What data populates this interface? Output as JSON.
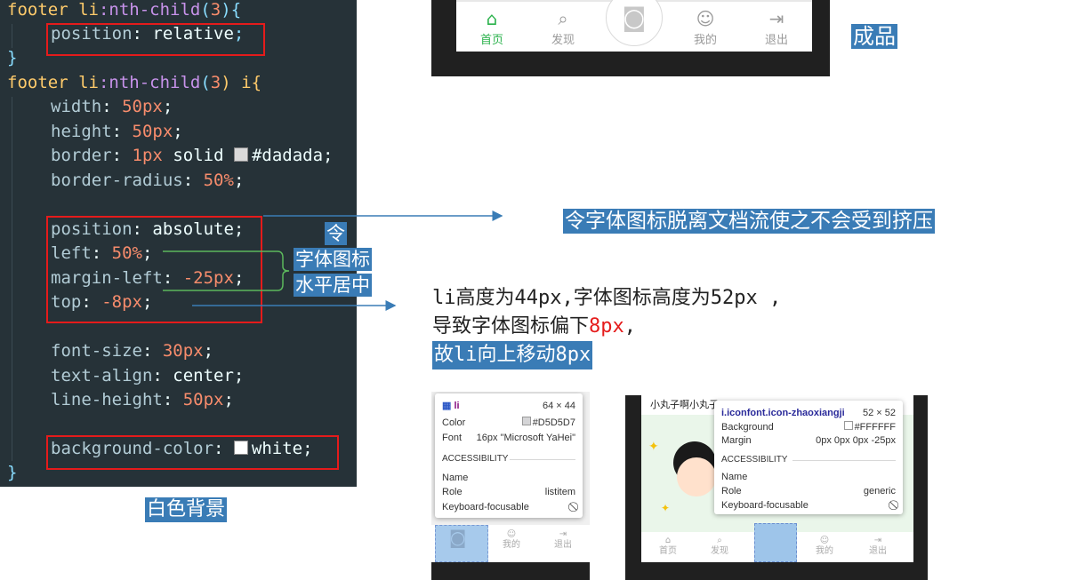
{
  "code": {
    "l1_sel": "footer li",
    "l1_pc": ":nth-child",
    "l1_open": "(",
    "l1_num": "3",
    "l1_close": "){",
    "l2_prop": "position",
    "l2_colon": ": ",
    "l2_val": "relative",
    "l2_semi": ";",
    "l3": "}",
    "l4_sel": "footer li",
    "l4_pc": ":nth-child",
    "l4_open": "(",
    "l4_num": "3",
    "l4_rest": ") i{",
    "l5_prop": "width",
    "l5_val": "50px",
    "l6_prop": "height",
    "l6_val": "50px",
    "l7_prop": "border",
    "l7_num": "1px",
    "l7_val": "solid",
    "l7_hex": "#dadada",
    "l8_prop": "border-radius",
    "l8_val": "50%",
    "l9_prop": "position",
    "l9_val": "absolute",
    "l10_prop": "left",
    "l10_val": "50%",
    "l11_prop": "margin-left",
    "l11_val": "-25px",
    "l12_prop": "top",
    "l12_val": "-8px",
    "l13_prop": "font-size",
    "l13_val": "30px",
    "l14_prop": "text-align",
    "l14_val": "center",
    "l15_prop": "line-height",
    "l15_val": "50px",
    "l16_prop": "background-color",
    "l16_val": "white",
    "l17": "}"
  },
  "labels": {
    "finished": "成品",
    "absolute_note": "令字体图标脱离文档流使之不会受到挤压",
    "center_note_1": "令",
    "center_note_2": "字体图标",
    "center_note_3": "水平居中",
    "white_bg": "白色背景",
    "explain_1": "li高度为44px,字体图标高度为52px ,",
    "explain_2a": "导致字体图标偏下",
    "explain_2b": "8px",
    "explain_2c": ",",
    "explain_3": "故li向上移动8px"
  },
  "product": {
    "tabs": [
      "首页",
      "发现",
      "我的",
      "退出"
    ]
  },
  "devtools_li": {
    "tag": "li",
    "size": "64 × 44",
    "color_label": "Color",
    "color_value": "#D5D5D7",
    "font_label": "Font",
    "font_value": "16px \"Microsoft YaHei\"",
    "accessibility": "ACCESSIBILITY",
    "name_label": "Name",
    "role_label": "Role",
    "role_value": "listitem",
    "kf_label": "Keyboard-focusable",
    "tabs": [
      "我的",
      "退出"
    ]
  },
  "devtools_i": {
    "header_text": "小丸子啊小丸子",
    "tag": "i.iconfont.icon-zhaoxiangji",
    "size": "52 × 52",
    "bg_label": "Background",
    "bg_value": "#FFFFFF",
    "margin_label": "Margin",
    "margin_value": "0px 0px 0px -25px",
    "accessibility": "ACCESSIBILITY",
    "name_label": "Name",
    "role_label": "Role",
    "role_value": "generic",
    "kf_label": "Keyboard-focusable",
    "tabs": [
      "首页",
      "发现",
      "我的",
      "退出"
    ]
  },
  "colors": {
    "code_bg": "#263238",
    "highlight_box": "#e51b1b",
    "label_bg": "#3a7cb6",
    "active_tab": "#2bb24c"
  }
}
